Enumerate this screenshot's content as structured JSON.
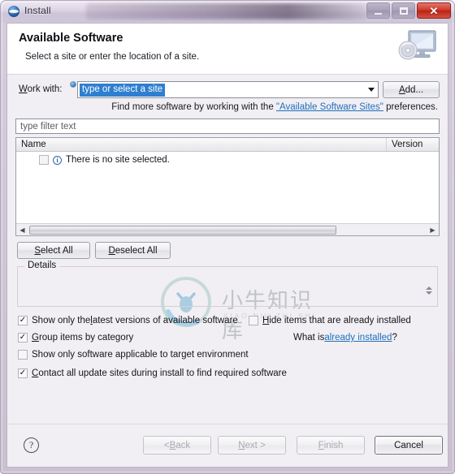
{
  "window": {
    "title": "Install",
    "title_icon": "eclipse-globe-icon",
    "controls": {
      "minimize": "minimize-icon",
      "maximize": "maximize-icon",
      "close": "✕"
    }
  },
  "banner": {
    "title": "Available Software",
    "description": "Select a site or enter the location of a site.",
    "icon": "monitor-with-disc-icon"
  },
  "work_with": {
    "label_prefix": "W",
    "label_rest": "ork with:",
    "assist_badge": "content-assist-icon",
    "combo_value": "type or select a site",
    "combo_selected": true,
    "add_button": {
      "prefix": "A",
      "rest": "dd..."
    }
  },
  "hint": {
    "before": "Find more software by working with the ",
    "link": "\"Available Software Sites\"",
    "after": " preferences."
  },
  "filter": {
    "placeholder": "type filter text"
  },
  "tree": {
    "columns": [
      "Name",
      "Version"
    ],
    "row": {
      "checked": false,
      "icon": "info-icon",
      "icon_glyph": "i",
      "text": "There is no site selected."
    },
    "scrollbar": {
      "left_arrow": "◀",
      "right_arrow": "▶"
    }
  },
  "watermark": {
    "chinese": "小牛知识库",
    "pinyin": "XIAO NIU ZHI SHI KU"
  },
  "selection_buttons": {
    "select_all": {
      "prefix": "S",
      "rest": "elect All"
    },
    "deselect_all": {
      "prefix": "D",
      "rest": "eselect All"
    }
  },
  "details": {
    "label": "Details",
    "content": ""
  },
  "options": [
    {
      "id": "latest",
      "checked": true,
      "prefix": "Show only the ",
      "accel": "l",
      "rest": "atest versions of available software"
    },
    {
      "id": "group",
      "checked": true,
      "prefix": "",
      "accel": "G",
      "rest": "roup items by category"
    },
    {
      "id": "target",
      "checked": false,
      "prefix": "",
      "accel": "S",
      "rest": "how only software applicable to target environment"
    },
    {
      "id": "contact",
      "checked": true,
      "prefix": "",
      "accel": "C",
      "rest": "ontact all update sites during install to find required software"
    },
    {
      "id": "hide",
      "checked": false,
      "prefix": "",
      "accel": "H",
      "rest": "ide items that are already installed"
    }
  ],
  "what_is": {
    "before": "What is ",
    "link": "already installed",
    "after": "?"
  },
  "footer": {
    "help_icon": "?",
    "buttons": [
      {
        "id": "back",
        "prefix": "< ",
        "accel": "B",
        "rest": "ack",
        "enabled": false
      },
      {
        "id": "next",
        "prefix": "",
        "accel": "N",
        "rest": "ext >",
        "enabled": false
      },
      {
        "id": "finish",
        "prefix": "",
        "accel": "F",
        "rest": "inish",
        "enabled": false
      },
      {
        "id": "cancel",
        "prefix": "",
        "accel": "",
        "rest": "Cancel",
        "enabled": true
      }
    ]
  },
  "colors": {
    "accent_blue": "#2f7fd0",
    "link": "#1f6fbd",
    "close_red": "#cf3b2d",
    "frame": "#cfc6d6"
  }
}
